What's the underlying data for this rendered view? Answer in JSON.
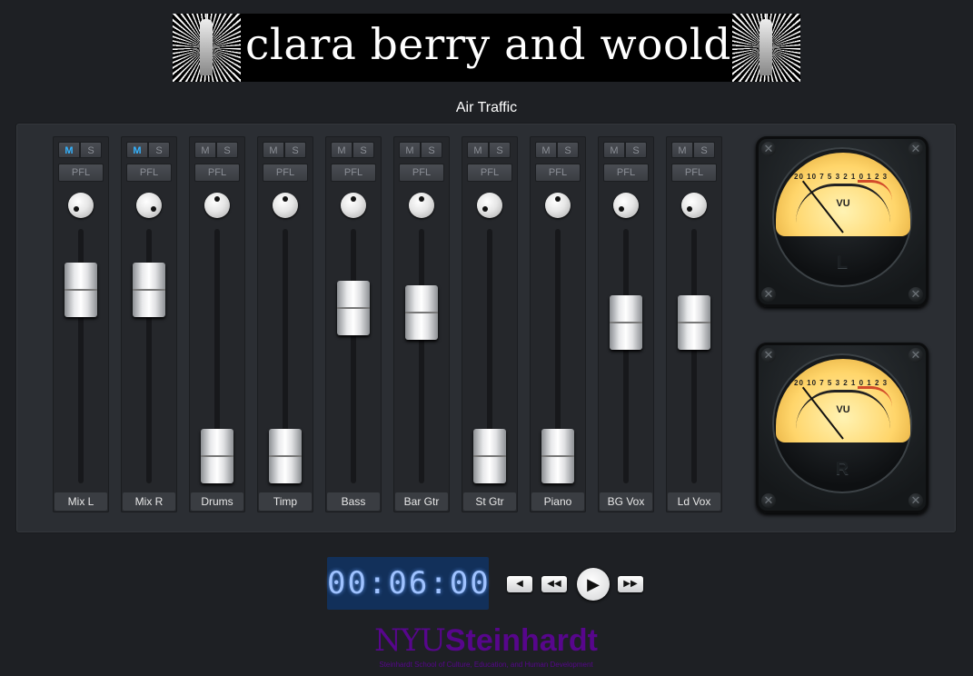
{
  "banner": {
    "title": "clara berry and wooldog"
  },
  "song_title": "Air Traffic",
  "colors": {
    "active_mute": "#34b3ff",
    "clock_bg": "#12305a",
    "brand": "#57068c"
  },
  "channels": [
    {
      "label": "Mix L",
      "mute_label": "M",
      "solo_label": "S",
      "pfl_label": "PFL",
      "mute_on": true,
      "pan": "left",
      "fader_level": 0.83
    },
    {
      "label": "Mix R",
      "mute_label": "M",
      "solo_label": "S",
      "pfl_label": "PFL",
      "mute_on": true,
      "pan": "right",
      "fader_level": 0.83
    },
    {
      "label": "Drums",
      "mute_label": "M",
      "solo_label": "S",
      "pfl_label": "PFL",
      "mute_on": false,
      "pan": "top",
      "fader_level": 0.0
    },
    {
      "label": "Timp",
      "mute_label": "M",
      "solo_label": "S",
      "pfl_label": "PFL",
      "mute_on": false,
      "pan": "top",
      "fader_level": 0.0
    },
    {
      "label": "Bass",
      "mute_label": "M",
      "solo_label": "S",
      "pfl_label": "PFL",
      "mute_on": false,
      "pan": "top",
      "fader_level": 0.74
    },
    {
      "label": "Bar Gtr",
      "mute_label": "M",
      "solo_label": "S",
      "pfl_label": "PFL",
      "mute_on": false,
      "pan": "top",
      "fader_level": 0.72
    },
    {
      "label": "St Gtr",
      "mute_label": "M",
      "solo_label": "S",
      "pfl_label": "PFL",
      "mute_on": false,
      "pan": "left",
      "fader_level": 0.0
    },
    {
      "label": "Piano",
      "mute_label": "M",
      "solo_label": "S",
      "pfl_label": "PFL",
      "mute_on": false,
      "pan": "top",
      "fader_level": 0.0
    },
    {
      "label": "BG Vox",
      "mute_label": "M",
      "solo_label": "S",
      "pfl_label": "PFL",
      "mute_on": false,
      "pan": "left",
      "fader_level": 0.67
    },
    {
      "label": "Ld Vox",
      "mute_label": "M",
      "solo_label": "S",
      "pfl_label": "PFL",
      "mute_on": false,
      "pan": "left",
      "fader_level": 0.67
    }
  ],
  "meters": [
    {
      "scale": "20 10 7 5 3 2 1 0 1 2 3",
      "vu_label": "VU",
      "channel": "L"
    },
    {
      "scale": "20 10 7 5 3 2 1 0 1 2 3",
      "vu_label": "VU",
      "channel": "R"
    }
  ],
  "transport": {
    "time": "00:06:00",
    "back_label": "◀",
    "rewind_label": "◀◀",
    "play_label": "▶",
    "forward_label": "▶▶"
  },
  "logo": {
    "nyu": "NYU",
    "steinhardt": "Steinhardt",
    "subtitle": "Steinhardt School of Culture, Education, and Human Development"
  }
}
